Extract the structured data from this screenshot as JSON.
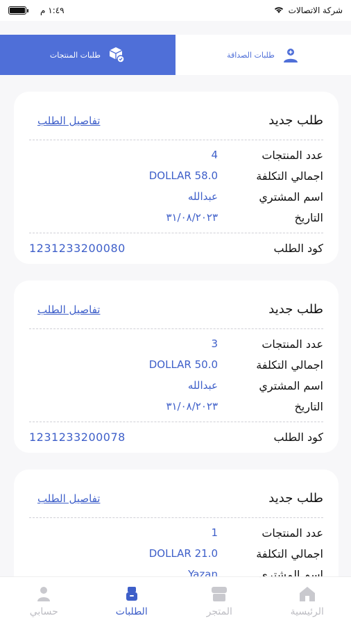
{
  "status_bar": {
    "carrier": "شركة الاتصالات",
    "time": "١:٤٩ م"
  },
  "tabs": [
    {
      "label": "طلبات المنتجات",
      "icon": "box-icon",
      "active": true
    },
    {
      "label": "طلبات الصداقة",
      "icon": "add-user-icon",
      "active": false
    }
  ],
  "orders": [
    {
      "title": "طلب جديد",
      "details_link": "تفاصيل الطلب",
      "rows": [
        {
          "label": "عدد المنتجات",
          "value": "4"
        },
        {
          "label": "اجمالي التكلفة",
          "value": "DOLLAR 58.0"
        },
        {
          "label": "اسم المشتري",
          "value": "عبدالله"
        },
        {
          "label": "التاريخ",
          "value": "٣١/٠٨/٢٠٢٣"
        }
      ],
      "code_label": "كود الطلب",
      "code_value": "1231233200080"
    },
    {
      "title": "طلب جديد",
      "details_link": "تفاصيل الطلب",
      "rows": [
        {
          "label": "عدد المنتجات",
          "value": "3"
        },
        {
          "label": "اجمالي التكلفة",
          "value": "DOLLAR 50.0"
        },
        {
          "label": "اسم المشتري",
          "value": "عبدالله"
        },
        {
          "label": "التاريخ",
          "value": "٣١/٠٨/٢٠٢٣"
        }
      ],
      "code_label": "كود الطلب",
      "code_value": "1231233200078"
    },
    {
      "title": "طلب جديد",
      "details_link": "تفاصيل الطلب",
      "rows": [
        {
          "label": "عدد المنتجات",
          "value": "1"
        },
        {
          "label": "اجمالي التكلفة",
          "value": "DOLLAR 21.0"
        },
        {
          "label": "اسم المشتري",
          "value": "Yazan"
        }
      ]
    }
  ],
  "bottom_nav": [
    {
      "label": "حسابي",
      "icon": "person-icon",
      "active": false
    },
    {
      "label": "الطلبات",
      "icon": "orders-icon",
      "active": true
    },
    {
      "label": "المتجر",
      "icon": "store-icon",
      "active": false
    },
    {
      "label": "الرئيسية",
      "icon": "home-icon",
      "active": false
    }
  ],
  "colors": {
    "accent": "#4f6fd8",
    "link": "#3e5fc9",
    "inactive": "#bdbdc3"
  }
}
